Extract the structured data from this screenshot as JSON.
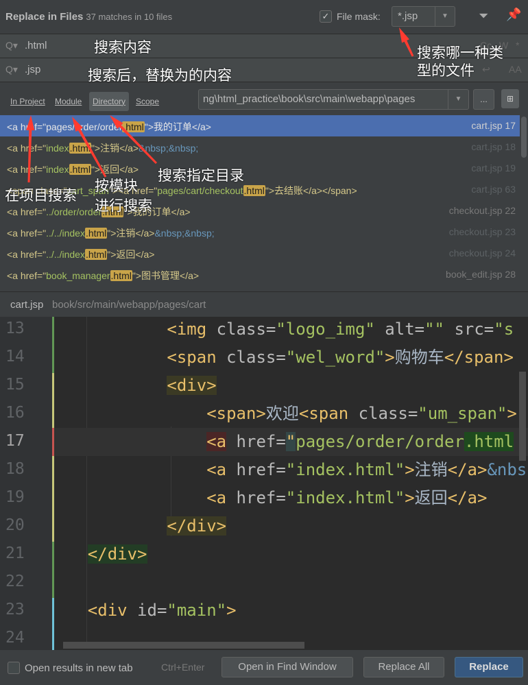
{
  "header": {
    "title": "Replace in Files",
    "count": "37 matches in 10 files",
    "file_mask_label": "File mask:",
    "file_mask_checked": true,
    "file_mask_value": "*.jsp",
    "filter_icon": "filter-icon",
    "pin_icon": "pin-icon"
  },
  "search": {
    "value": ".html",
    "icon": "search-icon"
  },
  "replace": {
    "value": ".jsp",
    "icon": "search-icon"
  },
  "scope": {
    "tabs": [
      "In Project",
      "Module",
      "Directory",
      "Scope"
    ],
    "selected": "Directory",
    "directory": "ng\\html_practice\\book\\src\\main\\webapp\\pages",
    "browse": "..."
  },
  "results": [
    {
      "tokens": [
        [
          "<a href=\"pages/order/order",
          "t"
        ],
        [
          ".html",
          "m"
        ],
        [
          "\">我的订单</a>",
          "t"
        ]
      ],
      "file": "cart.jsp 17",
      "selected": true,
      "dim": false
    },
    {
      "tokens": [
        [
          "<a href=\"",
          "t"
        ],
        [
          "index",
          "s"
        ],
        [
          ".html",
          "m"
        ],
        [
          "\">注销</a>",
          "t"
        ],
        [
          "&nbsp;&nbsp;",
          "e"
        ]
      ],
      "file": "cart.jsp 18",
      "dim": true
    },
    {
      "tokens": [
        [
          "<a href=\"",
          "t"
        ],
        [
          "index",
          "s"
        ],
        [
          ".html",
          "m"
        ],
        [
          "\">返回</a>",
          "t"
        ]
      ],
      "file": "cart.jsp 19",
      "dim": true
    },
    {
      "tokens": [
        [
          "<span class=\"",
          "t"
        ],
        [
          "cart_span",
          "s"
        ],
        [
          "\"><a href=\"",
          "t"
        ],
        [
          "pages/cart/checkout",
          "s"
        ],
        [
          ".html",
          "m"
        ],
        [
          "\">去结账</a></span>",
          "t"
        ]
      ],
      "file": "cart.jsp 63",
      "dim": true
    },
    {
      "tokens": [
        [
          "<a href=\"",
          "t"
        ],
        [
          "../order/order",
          "s"
        ],
        [
          ".html",
          "m"
        ],
        [
          "\">我的订单</a>",
          "t"
        ]
      ],
      "file": "checkout.jsp 22",
      "dim": false
    },
    {
      "tokens": [
        [
          "<a href=\"",
          "t"
        ],
        [
          "../../index",
          "s"
        ],
        [
          ".html",
          "m"
        ],
        [
          "\">注销</a>",
          "t"
        ],
        [
          "&nbsp;&nbsp;",
          "e"
        ]
      ],
      "file": "checkout.jsp 23",
      "dim": true
    },
    {
      "tokens": [
        [
          "<a href=\"",
          "t"
        ],
        [
          "../../index",
          "s"
        ],
        [
          ".html",
          "m"
        ],
        [
          "\">返回</a>",
          "t"
        ]
      ],
      "file": "checkout.jsp 24",
      "dim": true
    },
    {
      "tokens": [
        [
          "<a href=\"",
          "t"
        ],
        [
          "book_manager",
          "s"
        ],
        [
          ".html",
          "m"
        ],
        [
          "\">图书管理</a>",
          "t"
        ]
      ],
      "file": "book_edit.jsp 28",
      "dim": false
    }
  ],
  "preview": {
    "file": "cart.jsp",
    "path": "book/src/main/webapp/pages/cart",
    "current_line": 17,
    "lines": [
      {
        "n": 13,
        "tokens": [
          [
            "            ",
            ""
          ],
          [
            "<img ",
            "t"
          ],
          [
            "class=",
            "a"
          ],
          [
            "\"logo_img\" ",
            "s"
          ],
          [
            "alt=",
            "a"
          ],
          [
            "\"\" ",
            "s"
          ],
          [
            "src=",
            "a"
          ],
          [
            "\"s",
            "s"
          ]
        ]
      },
      {
        "n": 14,
        "tokens": [
          [
            "            ",
            ""
          ],
          [
            "<span ",
            "t"
          ],
          [
            "class=",
            "a"
          ],
          [
            "\"wel_word\"",
            "s"
          ],
          [
            ">",
            "t"
          ],
          [
            "购物车",
            "x"
          ],
          [
            "</span>",
            "t"
          ]
        ]
      },
      {
        "n": 15,
        "tokens": [
          [
            "            ",
            ""
          ],
          [
            "<div>",
            "t hb"
          ]
        ]
      },
      {
        "n": 16,
        "tokens": [
          [
            "                ",
            ""
          ],
          [
            "<span>",
            "t"
          ],
          [
            "欢迎",
            "x"
          ],
          [
            "<span ",
            "t"
          ],
          [
            "class=",
            "a"
          ],
          [
            "\"um_span\"",
            "s"
          ],
          [
            ">",
            "t"
          ]
        ]
      },
      {
        "n": 17,
        "tokens": [
          [
            "                ",
            ""
          ],
          [
            "<a",
            "t hr"
          ],
          [
            " href=",
            "a"
          ],
          [
            "\"",
            "t hc"
          ],
          [
            "pages/order/order",
            "s"
          ],
          [
            ".html",
            "s hm"
          ]
        ]
      },
      {
        "n": 18,
        "tokens": [
          [
            "                ",
            ""
          ],
          [
            "<a ",
            "t"
          ],
          [
            "href=",
            "a"
          ],
          [
            "\"index.html\"",
            "s"
          ],
          [
            ">",
            "t"
          ],
          [
            "注销",
            "x"
          ],
          [
            "</a>",
            "t"
          ],
          [
            "&nbsp;",
            "e"
          ]
        ]
      },
      {
        "n": 19,
        "tokens": [
          [
            "                ",
            ""
          ],
          [
            "<a ",
            "t"
          ],
          [
            "href=",
            "a"
          ],
          [
            "\"index.html\"",
            "s"
          ],
          [
            ">",
            "t"
          ],
          [
            "返回",
            "x"
          ],
          [
            "</a>",
            "t"
          ]
        ]
      },
      {
        "n": 20,
        "tokens": [
          [
            "            ",
            ""
          ],
          [
            "</div>",
            "t hb"
          ]
        ]
      },
      {
        "n": 21,
        "tokens": [
          [
            "    ",
            ""
          ],
          [
            "</div>",
            "t hg"
          ]
        ]
      },
      {
        "n": 22,
        "tokens": []
      },
      {
        "n": 23,
        "tokens": [
          [
            "    ",
            ""
          ],
          [
            "<div ",
            "t"
          ],
          [
            "id=",
            "a"
          ],
          [
            "\"main\"",
            "s"
          ],
          [
            ">",
            "t"
          ]
        ]
      },
      {
        "n": 24,
        "tokens": []
      }
    ]
  },
  "footer": {
    "new_tab_label": "Open results in new tab",
    "new_tab_checked": false,
    "shortcut": "Ctrl+Enter",
    "open_find_window": "Open in Find Window",
    "replace_all": "Replace All",
    "replace": "Replace"
  },
  "annotations": {
    "search_content": "搜索内容",
    "replace_content": "搜索后，替换为的内容",
    "file_type": "搜索哪一种类\n型的文件",
    "directory": "搜索指定目录",
    "module": "按模块\n进行搜索",
    "project": "在项目搜索",
    "arrow_color": "#ff3b30"
  },
  "colors": {
    "selection": "#4b6eaf",
    "match": "#c9a449",
    "primary_button": "#365880"
  }
}
